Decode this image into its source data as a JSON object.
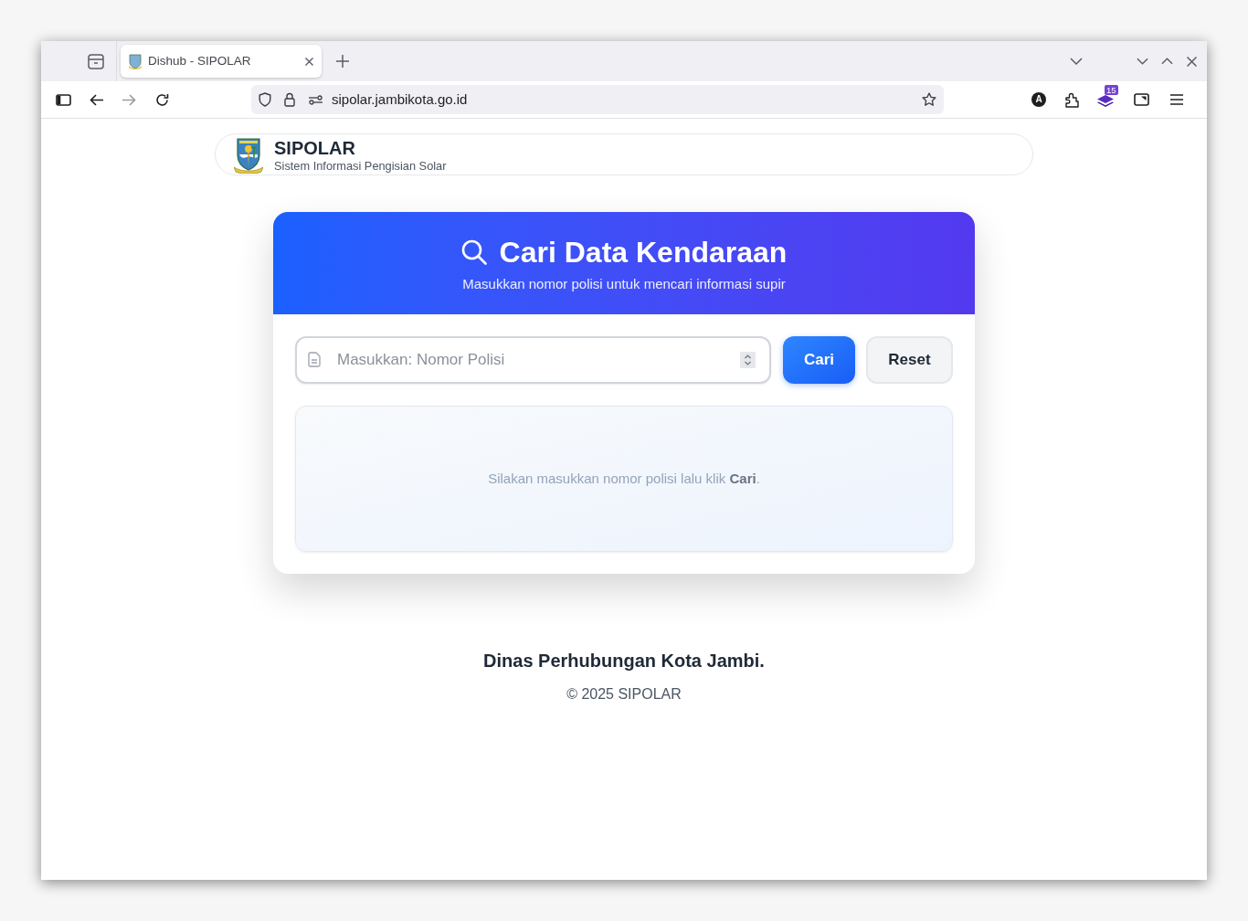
{
  "browser": {
    "tabs": [
      {
        "title": "Dishub - SIPOLAR",
        "selected": true
      }
    ],
    "url": "sipolar.jambikota.go.id",
    "profile_letter": "A",
    "extension_badge": "15"
  },
  "header": {
    "title": "SIPOLAR",
    "subtitle": "Sistem Informasi Pengisian Solar"
  },
  "search_card": {
    "title": "Cari Data Kendaraan",
    "subtitle": "Masukkan nomor polisi untuk mencari informasi supir",
    "input": {
      "placeholder": "Masukkan: Nomor Polisi"
    },
    "buttons": [
      {
        "label": "Cari",
        "kind": "primary"
      },
      {
        "label": "Reset",
        "kind": "secondary"
      }
    ],
    "result_message": "Silakan masukkan nomor polisi lalu klik **Cari**."
  },
  "footer": {
    "organization": "Dinas Perhubungan Kota Jambi.",
    "copyright": "© 2025 SIPOLAR"
  }
}
